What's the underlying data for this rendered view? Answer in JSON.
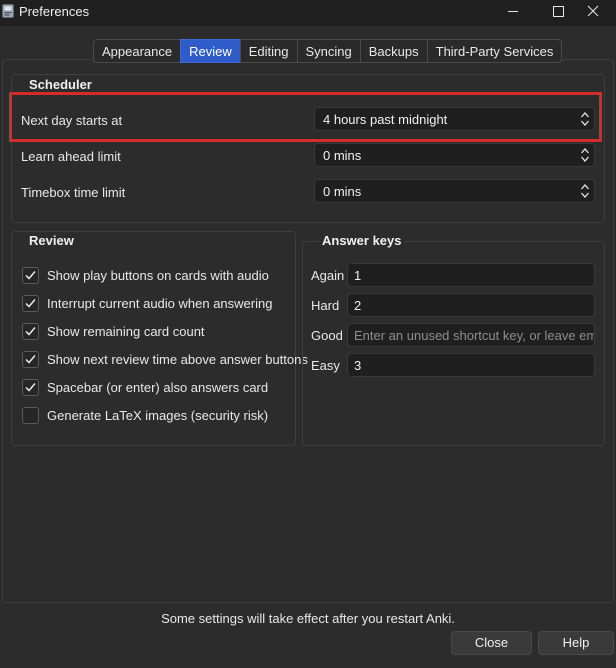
{
  "window": {
    "title": "Preferences"
  },
  "tabs": [
    {
      "label": "Appearance",
      "active": false
    },
    {
      "label": "Review",
      "active": true
    },
    {
      "label": "Editing",
      "active": false
    },
    {
      "label": "Syncing",
      "active": false
    },
    {
      "label": "Backups",
      "active": false
    },
    {
      "label": "Third-Party Services",
      "active": false
    }
  ],
  "scheduler": {
    "title": "Scheduler",
    "next_day_label": "Next day starts at",
    "next_day_value": "4 hours past midnight",
    "learn_ahead_label": "Learn ahead limit",
    "learn_ahead_value": "0 mins",
    "timebox_label": "Timebox time limit",
    "timebox_value": "0 mins"
  },
  "review": {
    "title": "Review",
    "options": [
      {
        "label": "Show play buttons on cards with audio",
        "checked": true
      },
      {
        "label": "Interrupt current audio when answering",
        "checked": true
      },
      {
        "label": "Show remaining card count",
        "checked": true
      },
      {
        "label": "Show next review time above answer buttons",
        "checked": true
      },
      {
        "label": "Spacebar (or enter) also answers card",
        "checked": true
      },
      {
        "label": "Generate LaTeX images (security risk)",
        "checked": false
      }
    ]
  },
  "answer_keys": {
    "title": "Answer keys",
    "keys": [
      {
        "label": "Again",
        "value": "1",
        "placeholder": ""
      },
      {
        "label": "Hard",
        "value": "2",
        "placeholder": ""
      },
      {
        "label": "Good",
        "value": "",
        "placeholder": "Enter an unused shortcut key, or leave em..."
      },
      {
        "label": "Easy",
        "value": "3",
        "placeholder": ""
      }
    ]
  },
  "footer": {
    "note": "Some settings will take effect after you restart Anki.",
    "close_label": "Close",
    "help_label": "Help"
  },
  "colors": {
    "accent": "#2f5cc8",
    "highlight": "#d62b2b",
    "background": "#2c2c2c"
  }
}
